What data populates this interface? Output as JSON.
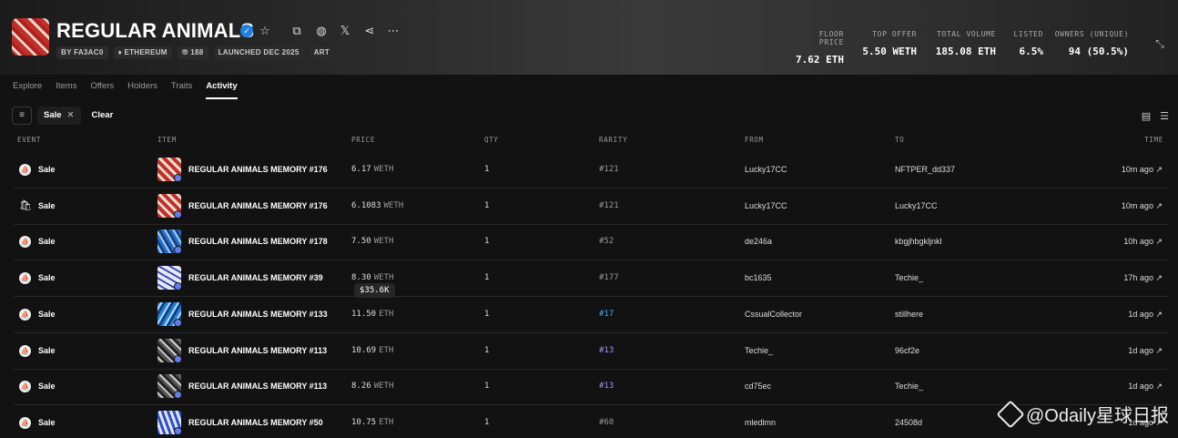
{
  "collection": {
    "title": "REGULAR ANIMALS",
    "tags": [
      "BY FA3AC0",
      "♦ ETHEREUM",
      "⛃ 188",
      "LAUNCHED DEC 2025",
      "ART"
    ]
  },
  "stats": [
    {
      "label": "FLOOR PRICE",
      "value": "7.62 ETH"
    },
    {
      "label": "TOP OFFER",
      "value": "5.50 WETH"
    },
    {
      "label": "TOTAL VOLUME",
      "value": "185.08 ETH"
    },
    {
      "label": "LISTED",
      "value": "6.5%"
    },
    {
      "label": "OWNERS (UNIQUE)",
      "value": "94 (50.5%)"
    }
  ],
  "tabs": [
    "Explore",
    "Items",
    "Offers",
    "Holders",
    "Traits",
    "Activity"
  ],
  "active_tab": "Activity",
  "filter": {
    "chip": "Sale",
    "clear": "Clear"
  },
  "columns": [
    "EVENT",
    "ITEM",
    "PRICE",
    "QTY",
    "RARITY",
    "FROM",
    "TO",
    "TIME"
  ],
  "rows": [
    {
      "event": "Sale",
      "icon": "opensea",
      "item": "REGULAR ANIMALS MEMORY #176",
      "price": "6.17",
      "currency": "WETH",
      "qty": "1",
      "rarity": "#121",
      "from": "Lucky17CC",
      "to": "NFTPER_dd337",
      "time": "10m ago ↗"
    },
    {
      "event": "Sale",
      "icon": "bag",
      "item": "REGULAR ANIMALS MEMORY #176",
      "price": "6.1083",
      "currency": "WETH",
      "qty": "1",
      "rarity": "#121",
      "from": "Lucky17CC",
      "to": "Lucky17CC",
      "time": "10m ago ↗"
    },
    {
      "event": "Sale",
      "icon": "opensea",
      "item": "REGULAR ANIMALS MEMORY #178",
      "price": "7.50",
      "currency": "WETH",
      "qty": "1",
      "rarity": "#52",
      "from": "de246a",
      "to": "kbgjhbgkljnkl",
      "time": "10h ago ↗"
    },
    {
      "event": "Sale",
      "icon": "opensea",
      "item": "REGULAR ANIMALS MEMORY #39",
      "price": "8.30",
      "currency": "WETH",
      "qty": "1",
      "rarity": "#177",
      "from": "bc1635",
      "to": "Techie_",
      "time": "17h ago ↗"
    },
    {
      "event": "Sale",
      "icon": "opensea",
      "item": "REGULAR ANIMALS MEMORY #133",
      "price": "11.50",
      "currency": "ETH",
      "qty": "1",
      "rarity": "#17",
      "from": "CssualCollector",
      "to": "stillhere",
      "time": "1d ago ↗"
    },
    {
      "event": "Sale",
      "icon": "opensea",
      "item": "REGULAR ANIMALS MEMORY #113",
      "price": "10.69",
      "currency": "ETH",
      "qty": "1",
      "rarity": "#13",
      "from": "Techie_",
      "to": "96cf2e",
      "time": "1d ago ↗"
    },
    {
      "event": "Sale",
      "icon": "opensea",
      "item": "REGULAR ANIMALS MEMORY #113",
      "price": "8.26",
      "currency": "WETH",
      "qty": "1",
      "rarity": "#13",
      "from": "cd75ec",
      "to": "Techie_",
      "time": "1d ago ↗"
    },
    {
      "event": "Sale",
      "icon": "opensea",
      "item": "REGULAR ANIMALS MEMORY #50",
      "price": "10.75",
      "currency": "ETH",
      "qty": "1",
      "rarity": "#60",
      "from": "mledlmn",
      "to": "24508d",
      "time": "1d ago ↗"
    }
  ],
  "tooltip": "$35.6K",
  "watermark": "@Odaily星球日报"
}
